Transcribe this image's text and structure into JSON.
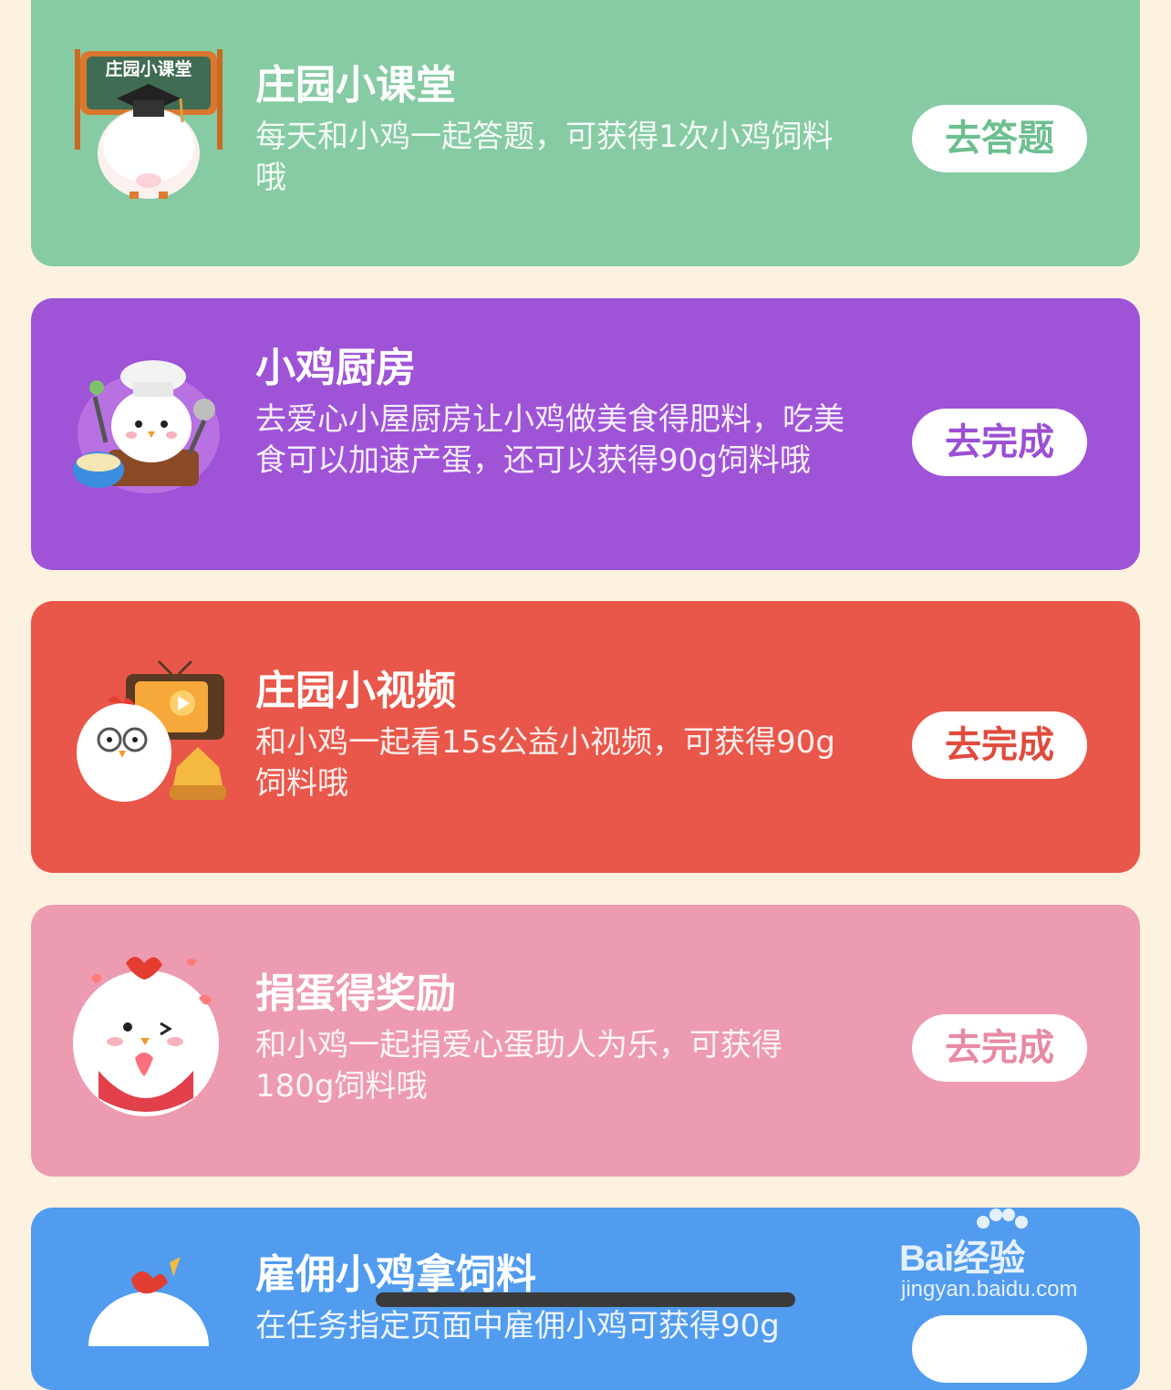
{
  "tasks": [
    {
      "title": "庄园小课堂",
      "desc": "每天和小鸡一起答题，可获得1次小鸡饲料哦",
      "button": "去答题",
      "bg_color": "#86cba3",
      "button_text_color": "#6dbf90",
      "icon": "chalkboard-chick-icon",
      "icon_text": "庄园小课堂"
    },
    {
      "title": "小鸡厨房",
      "desc": "去爱心小屋厨房让小鸡做美食得肥料，吃美食可以加速产蛋，还可以获得90g饲料哦",
      "button": "去完成",
      "bg_color": "#9f53d7",
      "button_text_color": "#9b4fd3",
      "icon": "chef-chick-icon"
    },
    {
      "title": "庄园小视频",
      "desc": "和小鸡一起看15s公益小视频，可获得90g饲料哦",
      "button": "去完成",
      "bg_color": "#e9574a",
      "button_text_color": "#e04b3e",
      "icon": "tv-chick-icon"
    },
    {
      "title": "捐蛋得奖励",
      "desc": "和小鸡一起捐爱心蛋助人为乐，可获得180g饲料哦",
      "button": "去完成",
      "bg_color": "#ed9bb1",
      "button_text_color": "#e88aa4",
      "icon": "heart-chick-icon"
    },
    {
      "title": "雇佣小鸡拿饲料",
      "desc": "在任务指定页面中雇佣小鸡可获得90g",
      "button": "",
      "bg_color": "#519cee",
      "button_text_color": "#519cee",
      "icon": "hire-chick-icon"
    }
  ],
  "watermark": {
    "brand": "Bai经验",
    "url": "jingyan.baidu.com"
  }
}
